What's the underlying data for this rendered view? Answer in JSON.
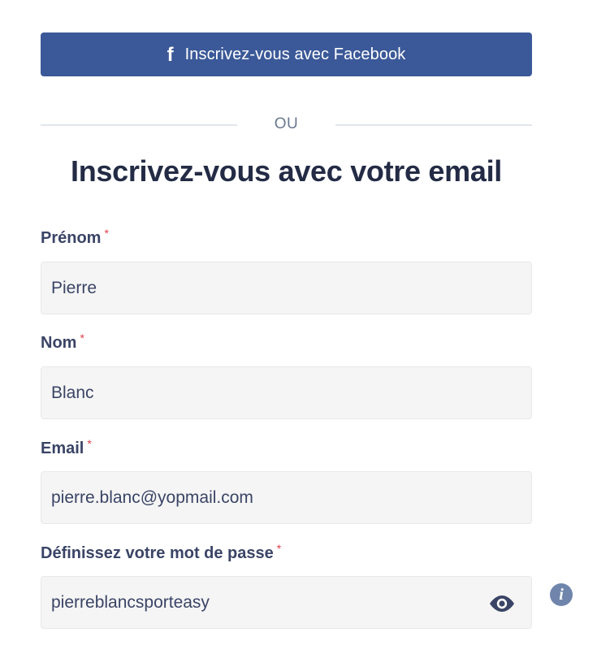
{
  "facebook_button": {
    "icon": "facebook-icon",
    "icon_glyph": "f",
    "label": "Inscrivez-vous avec Facebook",
    "color": "#3b5998"
  },
  "divider": {
    "text": "OU"
  },
  "form": {
    "title": "Inscrivez-vous avec votre email",
    "required_marker": "*",
    "required_color": "#e0404a",
    "fields": [
      {
        "label": "Prénom",
        "value": "Pierre"
      },
      {
        "label": "Nom",
        "value": "Blanc"
      },
      {
        "label": "Email",
        "value": "pierre.blanc@yopmail.com"
      },
      {
        "label": "Définissez votre mot de passe",
        "value": "pierreblancsporteasy"
      }
    ],
    "password_toggle_icon": "eye-icon",
    "info_icon": "info-icon",
    "info_glyph": "i"
  }
}
